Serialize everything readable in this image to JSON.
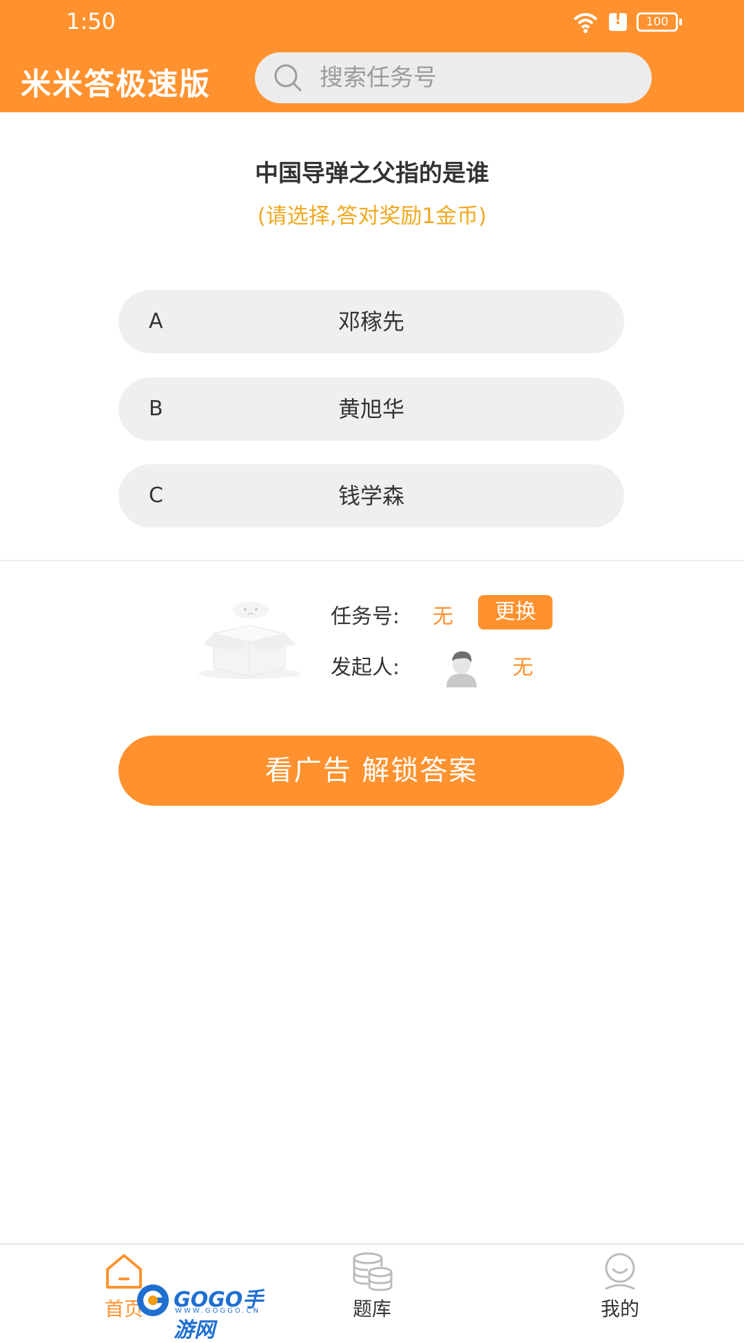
{
  "status_bar": {
    "time": "1:50",
    "battery": "100",
    "icons": [
      "wifi-icon",
      "alert-icon",
      "battery-icon"
    ]
  },
  "header": {
    "app_title": "米米答极速版",
    "search_placeholder": "搜索任务号"
  },
  "question": {
    "text": "中国导弹之父指的是谁",
    "hint": "(请选择,答对奖励1金币)"
  },
  "options": [
    {
      "letter": "A",
      "text": "邓稼先"
    },
    {
      "letter": "B",
      "text": "黄旭华"
    },
    {
      "letter": "C",
      "text": "钱学森"
    }
  ],
  "task": {
    "task_label": "任务号:",
    "task_value": "无",
    "change_label": "更换",
    "initiator_label": "发起人:",
    "initiator_value": "无"
  },
  "unlock_button": "看广告 解锁答案",
  "bottom_nav": [
    {
      "label": "首页",
      "icon": "home-icon",
      "active": true
    },
    {
      "label": "题库",
      "icon": "database-icon",
      "active": false
    },
    {
      "label": "我的",
      "icon": "profile-icon",
      "active": false
    }
  ],
  "watermark": {
    "text": "GOGO手游网",
    "sub": "WWW.GOGGO.CN"
  },
  "colors": {
    "accent": "#ff922f",
    "hint": "#f0a820",
    "option_bg": "#efefef"
  }
}
